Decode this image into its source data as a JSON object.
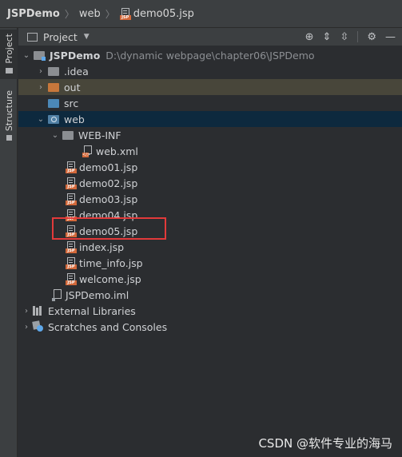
{
  "breadcrumb": {
    "project": "JSPDemo",
    "folder": "web",
    "file": "demo05.jsp",
    "file_icon_label": "JSP"
  },
  "tool_strip": {
    "project_tab": "Project",
    "structure_tab": "Structure"
  },
  "panel": {
    "title": "Project",
    "dropdown_icon": "chevron-down-icon",
    "toolbar_icons": [
      "locate-icon",
      "expand-all-icon",
      "collapse-all-icon",
      "gear-icon",
      "minimize-icon"
    ]
  },
  "tree": {
    "root": {
      "name": "JSPDemo",
      "path": "D:\\dynamic webpage\\chapter06\\JSPDemo"
    },
    "idea": ".idea",
    "out": "out",
    "src": "src",
    "web": "web",
    "web_inf": "WEB-INF",
    "web_xml": "web.xml",
    "jsp_files": [
      "demo01.jsp",
      "demo02.jsp",
      "demo03.jsp",
      "demo04.jsp",
      "demo05.jsp",
      "index.jsp",
      "time_info.jsp",
      "welcome.jsp"
    ],
    "iml": "JSPDemo.iml",
    "external_libraries": "External Libraries",
    "scratches": "Scratches and Consoles"
  },
  "colors": {
    "selection": "#0d293e",
    "highlight_box": "#e23a3a",
    "jsp_badge": "#d2683a"
  },
  "watermark": "CSDN @软件专业的海马"
}
